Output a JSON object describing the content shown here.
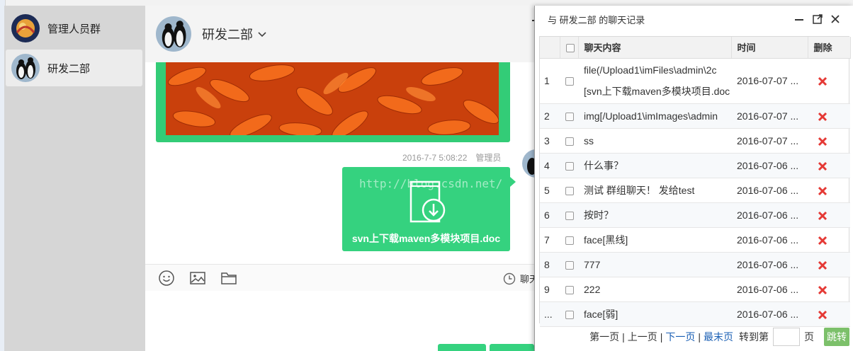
{
  "sessions": [
    {
      "name": "管理人员群"
    },
    {
      "name": "研发二部"
    }
  ],
  "chat": {
    "title": "研发二部",
    "message_time": "2016-7-7 5:08:22",
    "message_sender": "管理员",
    "file_name": "svn上下载maven多模块项目.doc",
    "watermark": "http://blog.csdn.net/",
    "history_label": "聊天"
  },
  "history": {
    "title": "与 研发二部 的聊天记录",
    "columns": {
      "content": "聊天内容",
      "time": "时间",
      "delete": "删除"
    },
    "rows": [
      {
        "idx": "1",
        "content": "file(/Upload1\\imFiles\\admin\\2c",
        "content2": "[svn上下载maven多模块项目.doc",
        "time": "2016-07-07 ..."
      },
      {
        "idx": "2",
        "content": "img[/Upload1\\imImages\\admin",
        "time": "2016-07-07 ..."
      },
      {
        "idx": "3",
        "content": "ss",
        "time": "2016-07-07 ..."
      },
      {
        "idx": "4",
        "content": "什么事？",
        "time": "2016-07-06 ..."
      },
      {
        "idx": "5",
        "content": "测试 群组聊天！ 发给test",
        "time": "2016-07-06 ..."
      },
      {
        "idx": "6",
        "content": "按时？",
        "time": "2016-07-06 ..."
      },
      {
        "idx": "7",
        "content": "face[黑线]",
        "time": "2016-07-06 ..."
      },
      {
        "idx": "8",
        "content": "777",
        "time": "2016-07-06 ..."
      },
      {
        "idx": "9",
        "content": "222",
        "time": "2016-07-06 ..."
      },
      {
        "idx": "...",
        "content": "face[弱]",
        "time": "2016-07-06 ..."
      }
    ],
    "pager": {
      "first": "第一页",
      "prev": "上一页",
      "next": "下一页",
      "last": "最末页",
      "goto_prefix": "转到第",
      "goto_suffix": "页",
      "go_button": "跳转"
    }
  },
  "colors": {
    "accent": "#35d27f",
    "delete": "#e53935",
    "link": "#1a5fb4",
    "go_button": "#7cc06a"
  },
  "icons": [
    "emoji-icon",
    "image-icon",
    "folder-icon",
    "clock-icon",
    "minimize-icon",
    "maximize-icon",
    "close-icon",
    "delete-icon",
    "download-icon",
    "chevron-down-icon"
  ]
}
